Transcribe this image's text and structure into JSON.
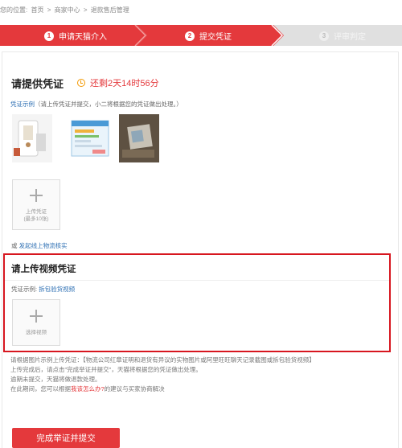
{
  "breadcrumb": {
    "prefix": "您的位置:",
    "items": [
      "首页",
      ">",
      "商家中心",
      ">",
      "退款售后管理"
    ]
  },
  "steps": [
    {
      "num": "1",
      "label": "申请天猫介入",
      "active": true
    },
    {
      "num": "2",
      "label": "提交凭证",
      "active": true
    },
    {
      "num": "3",
      "label": "评审判定",
      "active": false
    }
  ],
  "evidence": {
    "title": "请提供凭证",
    "countdown": "还剩2天14时56分",
    "example_link": "凭证示例",
    "example_note": "（请上传凭证并提交，小二将根据您的凭证做出处理。）",
    "upload_label": "上传凭证",
    "upload_limit": "(最多10张)",
    "or_prefix": "或",
    "or_link": "发起线上物流核实"
  },
  "video": {
    "title": "请上传视频凭证",
    "example_prefix": "凭证示例:",
    "example_link": "拆包验货视频",
    "upload_label": "选择视频"
  },
  "notes": {
    "line1": "请根据图片示例上传凭证：【物流公司红章证明和退货有异议的实物图片或阿里旺旺聊天记录截图或拆包验货视频】",
    "line2": "上传完成后，请点击\"完成举证并提交\"，天猫将根据您的凭证做出处理。",
    "line3": "逾期未提交，天猫将做退款处理。",
    "line4_prefix": "在此期间，您可以根据",
    "line4_link": "我该怎么办?",
    "line4_suffix": "的建议与买家协商解决"
  },
  "submit_label": "完成举证并提交",
  "colors": {
    "accent": "#e4393c",
    "highlight_border": "#d7161f",
    "link": "#2d6fb3",
    "step_inactive": "#e0e0e0"
  }
}
